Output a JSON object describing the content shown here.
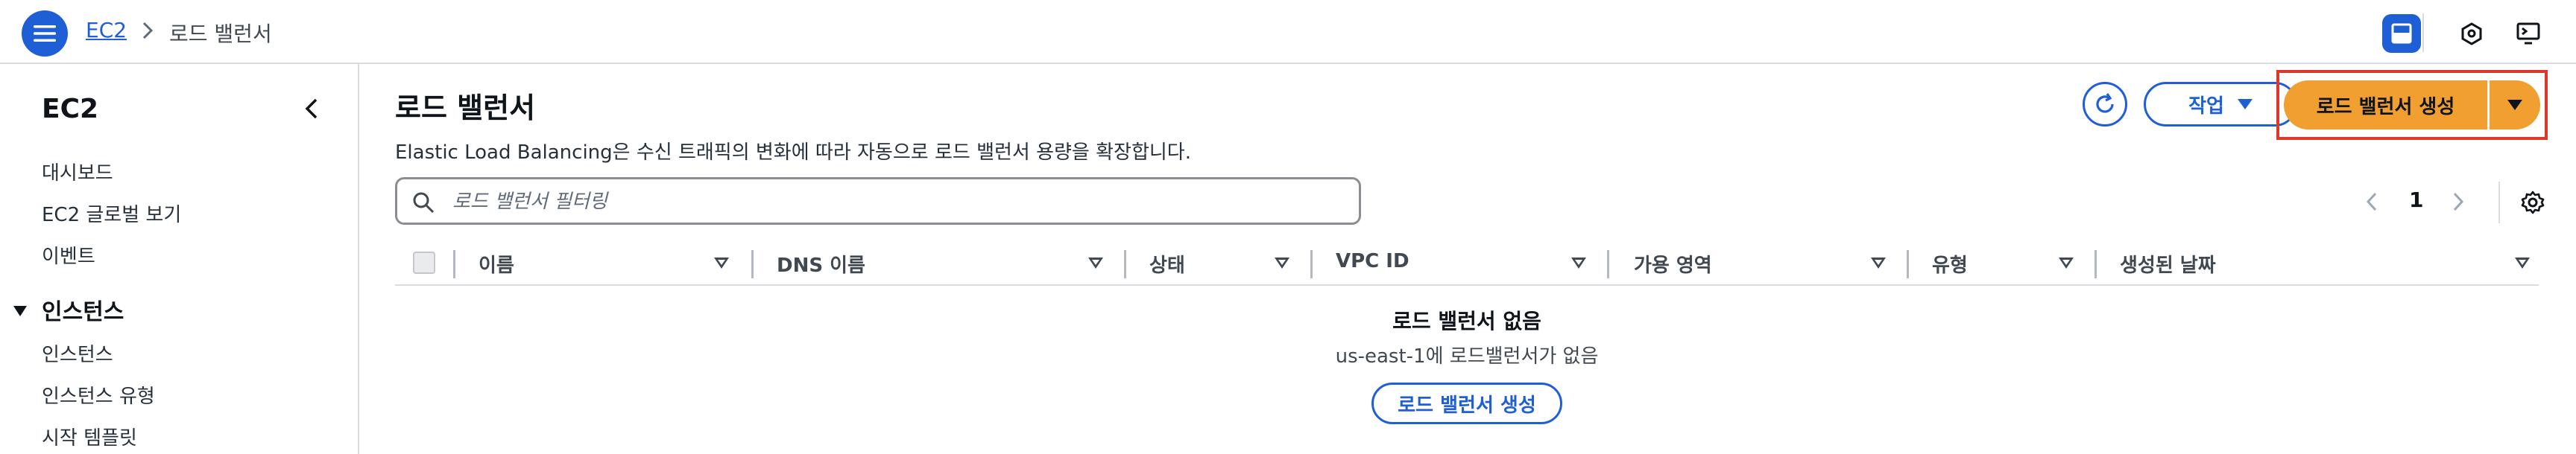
{
  "topbar": {
    "breadcrumb": {
      "root": "EC2",
      "current": "로드 밸런서"
    }
  },
  "sidebar": {
    "title": "EC2",
    "items": [
      {
        "label": "대시보드"
      },
      {
        "label": "EC2 글로벌 보기"
      },
      {
        "label": "이벤트"
      }
    ],
    "group": {
      "label": "인스턴스",
      "items": [
        {
          "label": "인스턴스"
        },
        {
          "label": "인스턴스 유형"
        },
        {
          "label": "시작 템플릿"
        }
      ]
    }
  },
  "main": {
    "title": "로드 밸런서",
    "description": "Elastic Load Balancing은 수신 트래픽의 변화에 따라 자동으로 로드 밸런서 용량을 확장합니다.",
    "actions_label": "작업",
    "create_label": "로드 밸런서 생성",
    "filter": {
      "placeholder": "로드 밸런서 필터링",
      "value": ""
    },
    "pagination": {
      "page": "1"
    },
    "table": {
      "columns": [
        "이름",
        "DNS 이름",
        "상태",
        "VPC ID",
        "가용 영역",
        "유형",
        "생성된 날짜"
      ],
      "rows": []
    },
    "empty_state": {
      "title": "로드 밸런서 없음",
      "subtitle": "us-east-1에 로드밸런서가 없음",
      "button_label": "로드 밸런서 생성"
    }
  },
  "icons": {
    "menu": "menu-icon",
    "chevron": "chevron-right-icon",
    "split_panel": "split-panel-icon",
    "notifications": "hexagon-icon",
    "cloudshell": "terminal-screen-icon",
    "collapse": "chevron-left-icon",
    "refresh": "refresh-icon",
    "search": "search-icon",
    "settings": "gear-icon"
  },
  "colors": {
    "accent": "#1f5fd6",
    "primary_button": "#f09f30",
    "highlight_box": "#e0372d"
  }
}
